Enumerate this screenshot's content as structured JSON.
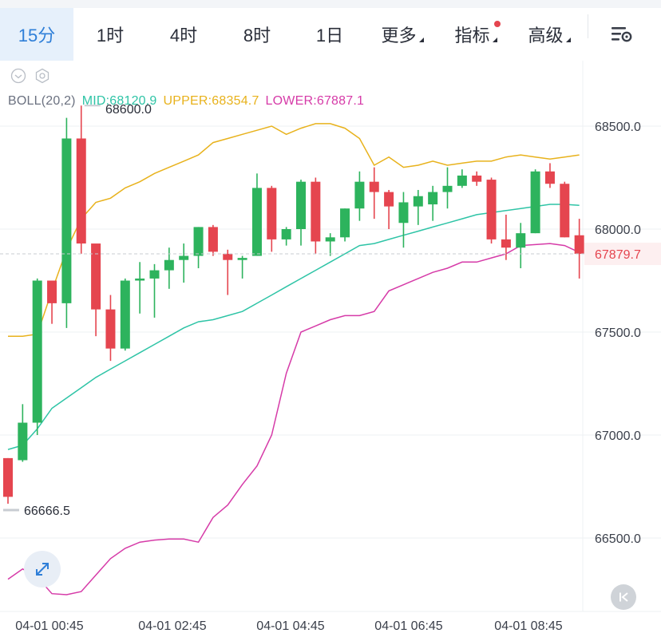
{
  "tabs": [
    {
      "label": "15分",
      "active": true
    },
    {
      "label": "1时",
      "active": false
    },
    {
      "label": "4时",
      "active": false
    },
    {
      "label": "8时",
      "active": false
    },
    {
      "label": "1日",
      "active": false
    },
    {
      "label": "更多",
      "active": false,
      "dropdown": true
    },
    {
      "label": "指标",
      "active": false,
      "dropdown": true,
      "notification_dot": true
    },
    {
      "label": "高级",
      "active": false,
      "dropdown": true
    }
  ],
  "icons": {
    "settings": "chart-settings-icon",
    "eye": "eye-icon",
    "gear": "indicator-settings-icon",
    "expand": "expand-icon",
    "back": "scroll-to-latest-icon"
  },
  "indicator": {
    "name": "BOLL(20,2)",
    "mid_label": "MID:68120.9",
    "upper_label": "UPPER:68354.7",
    "lower_label": "LOWER:67887.1"
  },
  "colors": {
    "active_tab": "#2f7fd8",
    "up": "#2db35d",
    "down": "#e5454f",
    "mid": "#2ec4a6",
    "upper": "#e8b21c",
    "lower": "#d63ba8",
    "grid": "#eef0f3",
    "axis_text": "#3a3f4a"
  },
  "chart_data": {
    "type": "candlestick",
    "ylim": [
      66166,
      68716
    ],
    "y_ticks": [
      "68500.0",
      "68000.0",
      "67500.0",
      "67000.0",
      "66500.0"
    ],
    "x_ticks": [
      "04-01 00:45",
      "04-01 02:45",
      "04-01 04:45",
      "04-01 06:45",
      "04-01 08:45"
    ],
    "current_price": "67879.7",
    "max_label": "68600.0",
    "min_label": "66666.5",
    "candles": [
      [
        66888,
        66700,
        66888,
        66666.5
      ],
      [
        66878,
        67060,
        67150,
        66870
      ],
      [
        67060,
        67750,
        67760,
        67000
      ],
      [
        67750,
        67640,
        67730,
        67540
      ],
      [
        67640,
        68440,
        68540,
        67520
      ],
      [
        68440,
        67930,
        68600,
        67880
      ],
      [
        67930,
        67610,
        67880,
        67480
      ],
      [
        67610,
        67420,
        67680,
        67360
      ],
      [
        67420,
        67750,
        67760,
        67410
      ],
      [
        67750,
        67760,
        67840,
        67590
      ],
      [
        67760,
        67800,
        67830,
        67570
      ],
      [
        67800,
        67850,
        67910,
        67710
      ],
      [
        67850,
        67870,
        67930,
        67740
      ],
      [
        67870,
        68010,
        68010,
        67810
      ],
      [
        68010,
        67890,
        68020,
        67870
      ],
      [
        67880,
        67850,
        67900,
        67680
      ],
      [
        67850,
        67860,
        67870,
        67760
      ],
      [
        67870,
        68200,
        68270,
        67870
      ],
      [
        68200,
        67950,
        68210,
        67890
      ],
      [
        67950,
        68000,
        68010,
        67920
      ],
      [
        68000,
        68230,
        68240,
        67920
      ],
      [
        68230,
        67940,
        68250,
        67880
      ],
      [
        67940,
        67960,
        67980,
        67870
      ],
      [
        67960,
        68100,
        68100,
        67940
      ],
      [
        68100,
        68230,
        68280,
        68040
      ],
      [
        68230,
        68180,
        68300,
        68050
      ],
      [
        68180,
        68110,
        68190,
        68000
      ],
      [
        68030,
        68130,
        68180,
        67910
      ],
      [
        68110,
        68160,
        68190,
        68020
      ],
      [
        68120,
        68180,
        68210,
        68040
      ],
      [
        68180,
        68210,
        68300,
        68100
      ],
      [
        68210,
        68260,
        68290,
        68200
      ],
      [
        68260,
        68230,
        68280,
        68210
      ],
      [
        68240,
        67950,
        68250,
        67930
      ],
      [
        67950,
        67910,
        68070,
        67850
      ],
      [
        67910,
        67980,
        68030,
        67810
      ],
      [
        67980,
        68280,
        68290,
        67980
      ],
      [
        68280,
        68220,
        68320,
        68200
      ],
      [
        68220,
        67960,
        68230,
        67960
      ],
      [
        67970,
        67880,
        68050,
        67760
      ]
    ],
    "boll_upper": [
      67480,
      67480,
      67490,
      67700,
      67900,
      68050,
      68130,
      68150,
      68200,
      68230,
      68270,
      68300,
      68330,
      68360,
      68420,
      68440,
      68460,
      68480,
      68500,
      68460,
      68490,
      68512,
      68512,
      68490,
      68440,
      68310,
      68350,
      68300,
      68310,
      68330,
      68310,
      68320,
      68330,
      68330,
      68350,
      68360,
      68350,
      68340,
      68350,
      68360
    ],
    "boll_mid": [
      66930,
      66950,
      67030,
      67130,
      67180,
      67230,
      67280,
      67320,
      67360,
      67400,
      67440,
      67480,
      67520,
      67550,
      67560,
      67580,
      67600,
      67640,
      67680,
      67720,
      67760,
      67800,
      67840,
      67880,
      67920,
      67930,
      67950,
      67970,
      67990,
      68010,
      68030,
      68050,
      68070,
      68080,
      68090,
      68100,
      68110,
      68120,
      68120,
      68115
    ],
    "boll_lower": [
      66300,
      66350,
      66310,
      66230,
      66225,
      66240,
      66320,
      66400,
      66450,
      66480,
      66490,
      66495,
      66495,
      66480,
      66600,
      66660,
      66760,
      66850,
      67000,
      67300,
      67500,
      67530,
      67560,
      67580,
      67580,
      67600,
      67700,
      67730,
      67760,
      67790,
      67810,
      67840,
      67840,
      67860,
      67880,
      67920,
      67925,
      67930,
      67920,
      67887
    ]
  }
}
